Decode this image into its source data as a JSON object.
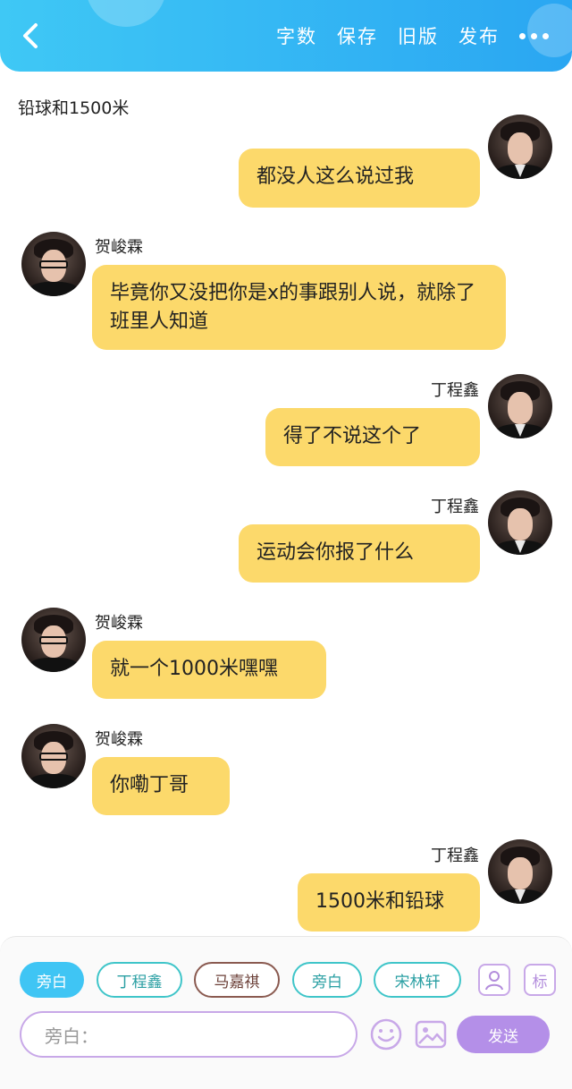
{
  "header": {
    "actions": [
      "字数",
      "保存",
      "旧版",
      "发布"
    ]
  },
  "topic": "铅球和1500米",
  "messages": [
    {
      "side": "right",
      "speaker": "",
      "text": "都没人这么说过我"
    },
    {
      "side": "left",
      "speaker": "贺峻霖",
      "text": "毕竟你又没把你是x的事跟别人说，就除了班里人知道"
    },
    {
      "side": "right",
      "speaker": "丁程鑫",
      "text": "得了不说这个了"
    },
    {
      "side": "right",
      "speaker": "丁程鑫",
      "text": "运动会你报了什么"
    },
    {
      "side": "left",
      "speaker": "贺峻霖",
      "text": "就一个1000米嘿嘿"
    },
    {
      "side": "left",
      "speaker": "贺峻霖",
      "text": "你嘞丁哥"
    },
    {
      "side": "right",
      "speaker": "丁程鑫",
      "text": "1500米和铅球"
    }
  ],
  "role_chips": [
    "旁白",
    "丁程鑫",
    "马嘉祺",
    "旁白",
    "宋林轩"
  ],
  "tools": {
    "user_icon": "person-card-icon",
    "tag_label": "标"
  },
  "composer": {
    "placeholder": "旁白：",
    "emoji_icon": "smiley-icon",
    "image_icon": "image-icon",
    "send_label": "发送"
  },
  "colors": {
    "header": "#2aa6f2",
    "bubble": "#fcd96b",
    "accent_purple": "#b48fe8",
    "chip_teal": "#3fc5c9",
    "chip_brown": "#8a5a50"
  }
}
